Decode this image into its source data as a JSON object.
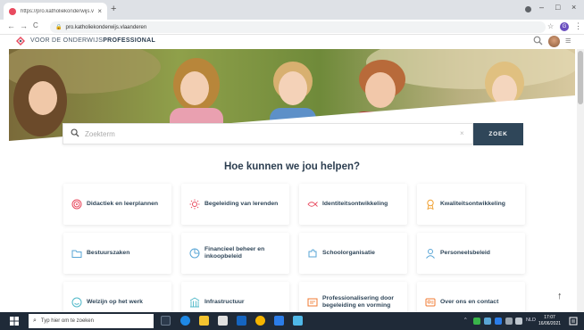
{
  "browser": {
    "tab_title": "https://pro.katholiekonderwijs.v",
    "tab_close": "×",
    "new_tab": "+",
    "url": "pro.katholiekonderwijs.vlaanderen",
    "nav_back": "←",
    "nav_forward": "→",
    "nav_reload": "C",
    "star": "☆",
    "profile_initial": "G",
    "menu": "⋮",
    "win_min": "–",
    "win_max": "□",
    "win_close": "×"
  },
  "site": {
    "title_prefix": "VOOR DE ONDERWIJS",
    "title_bold": "PROFESSIONAL",
    "search_icon": "⌕",
    "menu_icon": "≡"
  },
  "search": {
    "placeholder": "Zoekterm",
    "value": "",
    "clear": "×",
    "button_label": "ZOEK"
  },
  "help_title": "Hoe kunnen we jou helpen?",
  "cards": [
    {
      "label": "Didactiek en leerplannen",
      "icon": "target-icon"
    },
    {
      "label": "Begeleiding van lerenden",
      "icon": "sun-icon"
    },
    {
      "label": "Identiteitsontwikkeling",
      "icon": "fish-icon"
    },
    {
      "label": "Kwaliteitsontwikkeling",
      "icon": "badge-icon"
    },
    {
      "label": "Bestuurszaken",
      "icon": "folder-icon"
    },
    {
      "label": "Financieel beheer en inkoopbeleid",
      "icon": "pie-chart-icon"
    },
    {
      "label": "Schoolorganisatie",
      "icon": "puzzle-icon"
    },
    {
      "label": "Personeelsbeleid",
      "icon": "person-icon"
    },
    {
      "label": "Welzijn op het werk",
      "icon": "smile-icon"
    },
    {
      "label": "Infrastructuur",
      "icon": "building-icon"
    },
    {
      "label": "Professionalisering door begeleiding en vorming",
      "icon": "certificate-icon"
    },
    {
      "label": "Over ons en contact",
      "icon": "contact-card-icon"
    }
  ],
  "back_to_top": "↑",
  "taskbar": {
    "search_placeholder": "Typ hier om te zoeken",
    "tray_text": "NLD",
    "time": "17:07",
    "date": "16/06/2021"
  },
  "colors": {
    "accent": "#e84a5f",
    "button": "#2f4659",
    "title": "#2c3e50",
    "taskbar": "#1f2a38"
  }
}
